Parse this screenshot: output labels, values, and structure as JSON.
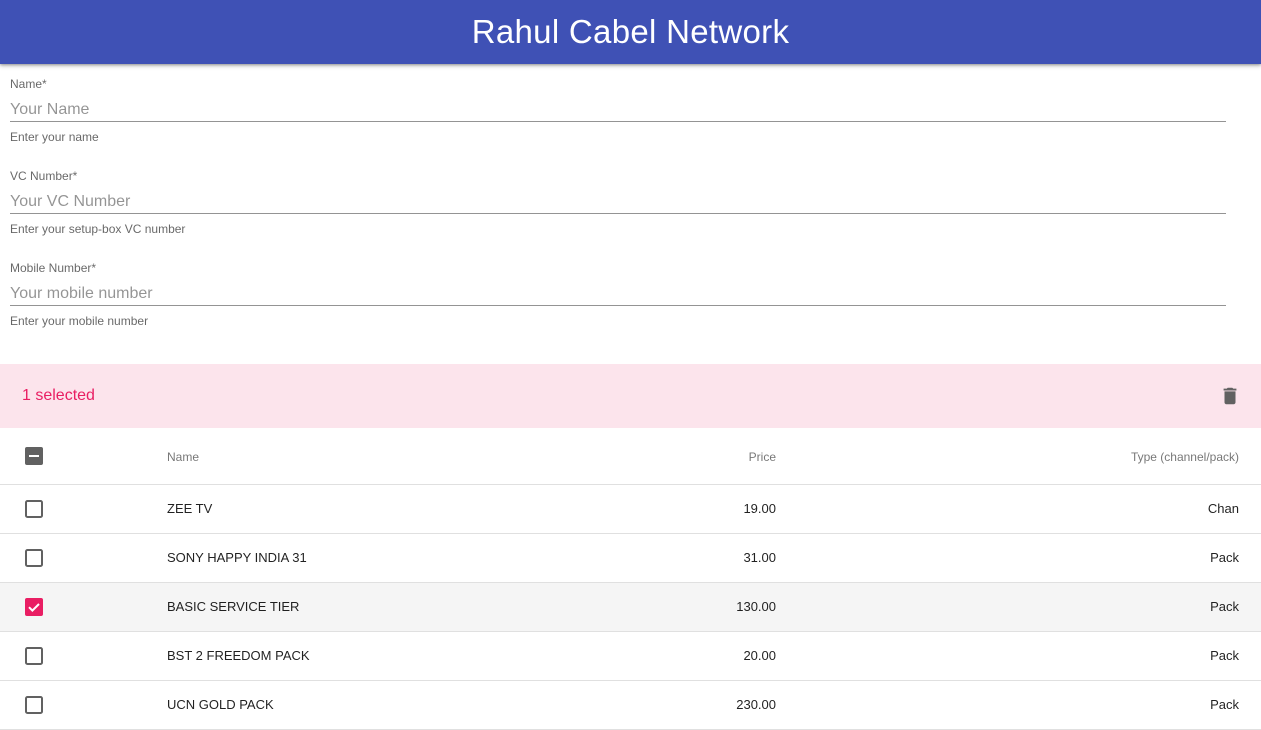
{
  "app": {
    "title": "Rahul Cabel Network"
  },
  "form": {
    "name": {
      "label": "Name*",
      "placeholder": "Your Name",
      "value": "",
      "helper": "Enter your name"
    },
    "vc": {
      "label": "VC Number*",
      "placeholder": "Your VC Number",
      "value": "",
      "helper": "Enter your setup-box VC number"
    },
    "mobile": {
      "label": "Mobile Number*",
      "placeholder": "Your mobile number",
      "value": "",
      "helper": "Enter your mobile number"
    }
  },
  "toolbar": {
    "selected_text": "1 selected",
    "delete_icon": "trash-icon"
  },
  "table": {
    "headers": {
      "name": "Name",
      "price": "Price",
      "type": "Type (channel/pack)"
    },
    "select_all_state": "indeterminate",
    "rows": [
      {
        "name": "ZEE TV",
        "price": "19.00",
        "type": "Chan",
        "checked": false
      },
      {
        "name": "SONY HAPPY INDIA 31",
        "price": "31.00",
        "type": "Pack",
        "checked": false
      },
      {
        "name": "BASIC SERVICE TIER",
        "price": "130.00",
        "type": "Pack",
        "checked": true
      },
      {
        "name": "BST 2 FREEDOM PACK",
        "price": "20.00",
        "type": "Pack",
        "checked": false
      },
      {
        "name": "UCN GOLD PACK",
        "price": "230.00",
        "type": "Pack",
        "checked": false
      }
    ]
  },
  "colors": {
    "appbar": "#3f51b5",
    "accent": "#e91e63",
    "selected_toolbar_bg": "#fce4ec",
    "selected_row_bg": "#f5f5f5",
    "checkbox_unchecked": "#616161"
  }
}
